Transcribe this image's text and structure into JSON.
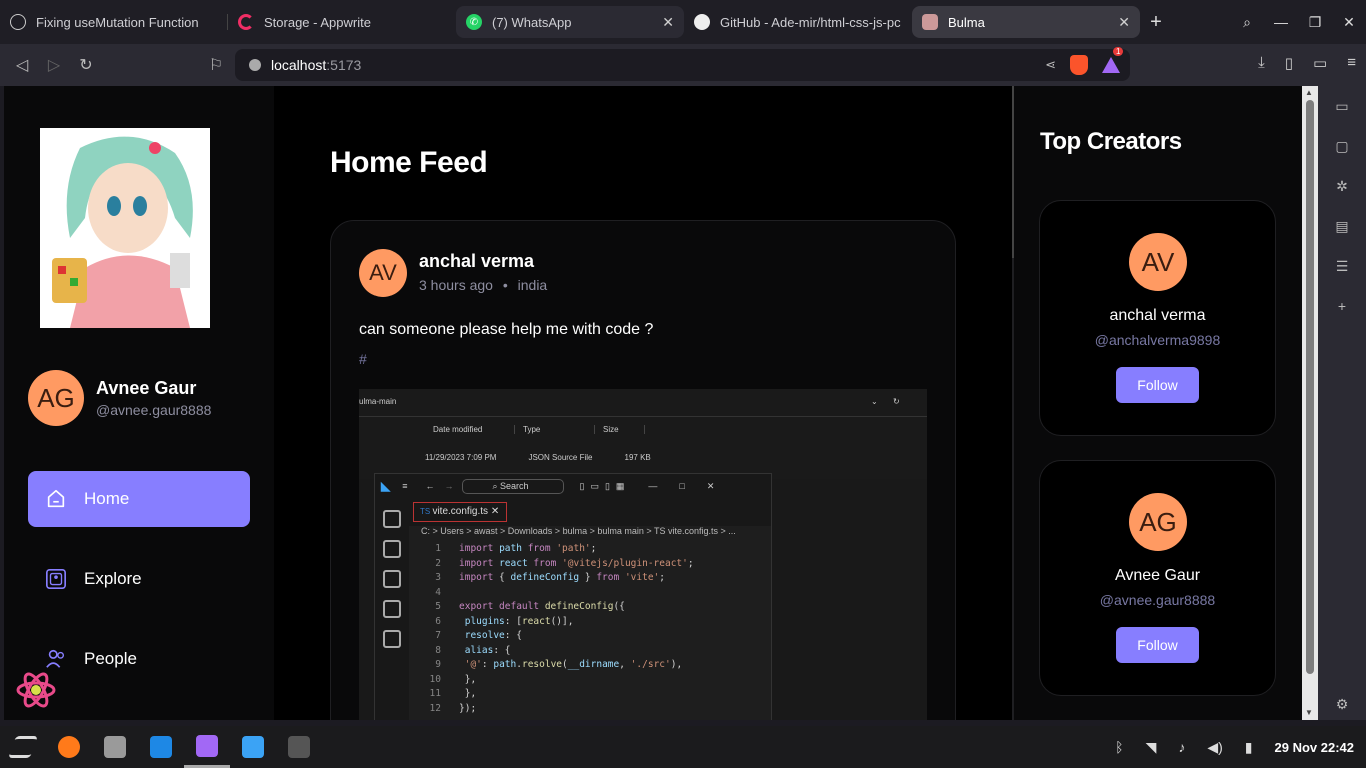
{
  "browser": {
    "tabs": [
      {
        "label": "Fixing useMutation Function",
        "icon": "chatgpt-icon"
      },
      {
        "label": "Storage - Appwrite",
        "icon": "appwrite-icon"
      },
      {
        "label": "(7) WhatsApp",
        "icon": "whatsapp-icon"
      },
      {
        "label": "GitHub - Ade-mir/html-css-js-pc",
        "icon": "github-icon"
      },
      {
        "label": "Bulma",
        "icon": "bulma-icon"
      }
    ],
    "url_host": "localhost",
    "url_port": ":5173",
    "brave_badge": "1"
  },
  "sidebar": {
    "user": {
      "initials": "AG",
      "name": "Avnee Gaur",
      "handle": "@avnee.gaur8888"
    },
    "nav": [
      {
        "label": "Home",
        "icon": "home-icon"
      },
      {
        "label": "Explore",
        "icon": "gallery-icon"
      },
      {
        "label": "People",
        "icon": "people-icon"
      }
    ]
  },
  "feed": {
    "title": "Home Feed",
    "post": {
      "initials": "AV",
      "author": "anchal verma",
      "time": "3 hours ago",
      "location": "india",
      "caption": "can someone please help me with code ?",
      "tag": "#",
      "screenshot": {
        "explorer_path": "ulma-main",
        "cols": [
          "Date modified",
          "Type",
          "Size"
        ],
        "row": [
          "11/29/2023 7:09 PM",
          "JSON Source File",
          "197 KB"
        ],
        "vs_search": "Search",
        "vs_tab": "vite.config.ts",
        "vs_breadcrumb": "C: > Users > awast > Downloads > bulma > bulma main > TS vite.config.ts > ...",
        "code": [
          "import path from 'path';",
          "import react from '@vitejs/plugin-react';",
          "import { defineConfig } from 'vite';",
          "",
          "export default defineConfig({",
          "  plugins: [react()],",
          "  resolve: {",
          "    alias: {",
          "      '@': path.resolve(__dirname, './src'),",
          "    },",
          "  },",
          "});"
        ]
      }
    }
  },
  "top_creators": {
    "title": "Top Creators",
    "creators": [
      {
        "initials": "AV",
        "name": "anchal verma",
        "handle": "@anchalverma9898",
        "button": "Follow"
      },
      {
        "initials": "AG",
        "name": "Avnee Gaur",
        "handle": "@avnee.gaur8888",
        "button": "Follow"
      }
    ]
  },
  "taskbar": {
    "clock": "29 Nov 22:42"
  },
  "colors": {
    "accent": "#877eff",
    "avatar": "#ff9a62",
    "background": "#000000"
  }
}
